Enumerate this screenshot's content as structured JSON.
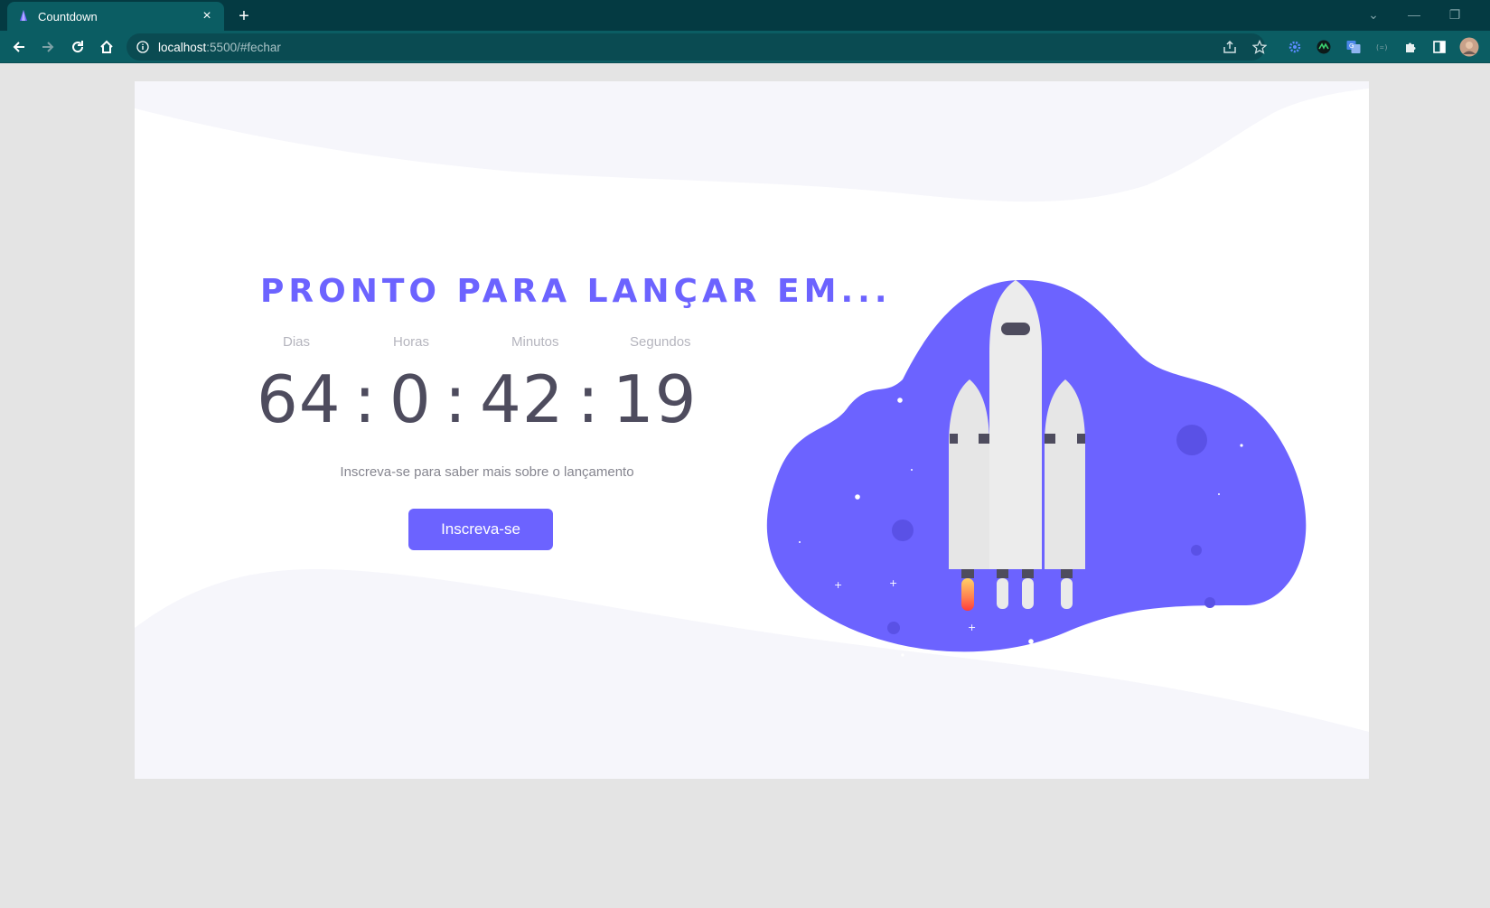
{
  "browser": {
    "tab_title": "Countdown",
    "close_glyph": "×",
    "new_tab_glyph": "+",
    "url_host": "localhost",
    "url_rest": ":5500/#fechar",
    "window_controls": [
      "⌄",
      "—",
      "❐"
    ]
  },
  "page": {
    "headline": "PRONTO PARA LANÇAR EM...",
    "units": {
      "days": "Dias",
      "hours": "Horas",
      "minutes": "Minutos",
      "seconds": "Segundos"
    },
    "countdown": {
      "days": "64",
      "hours": "0",
      "minutes": "42",
      "seconds": "19",
      "separator": ":"
    },
    "subtitle": "Inscreva-se para saber mais sobre o lançamento",
    "button_label": "Inscreva-se"
  },
  "colors": {
    "accent": "#6c63ff",
    "chrome_dark": "#043a42",
    "chrome": "#0b5d63",
    "page_background": "#e4e4e4",
    "wave": "#f6f6fb",
    "timer_text": "#4e4c5e"
  },
  "icons": [
    "rocket-favicon-icon",
    "back-arrow-icon",
    "forward-arrow-icon",
    "reload-icon",
    "home-icon",
    "info-icon",
    "share-icon",
    "star-icon",
    "extension-gear-icon",
    "extension-monitor-icon",
    "extension-translate-icon",
    "extension-dots-icon",
    "puzzle-icon",
    "sidebar-icon",
    "profile-avatar-icon"
  ]
}
